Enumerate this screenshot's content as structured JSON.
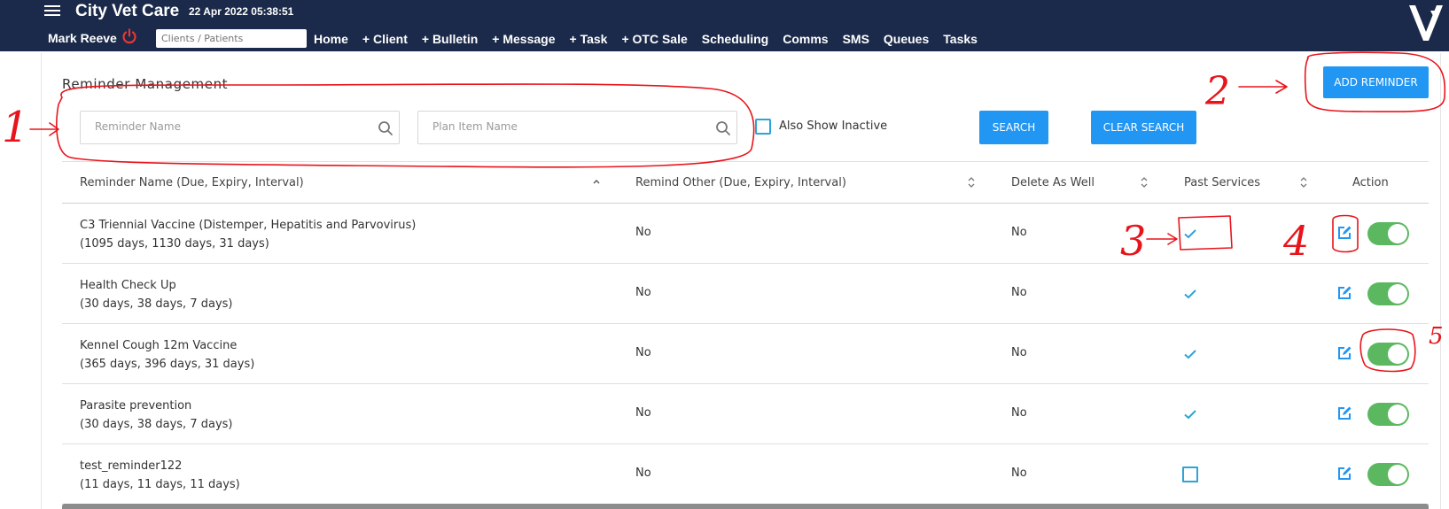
{
  "header": {
    "app_title": "City Vet Care",
    "datetime": "22 Apr 2022 05:38:51",
    "user_name": "Mark Reeve",
    "search_placeholder": "Clients / Patients",
    "nav": [
      "Home",
      "+ Client",
      "+ Bulletin",
      "+ Message",
      "+ Task",
      "+ OTC Sale",
      "Scheduling",
      "Comms",
      "SMS",
      "Queues",
      "Tasks"
    ],
    "colors": {
      "bar": "#1b2a4a",
      "power": "#e53935"
    }
  },
  "page": {
    "title": "Reminder Management",
    "reminder_name_placeholder": "Reminder Name",
    "plan_item_placeholder": "Plan Item Name",
    "also_show_inactive": "Also Show Inactive",
    "search_button": "SEARCH",
    "clear_search_button": "CLEAR SEARCH",
    "add_reminder_button": "ADD REMINDER",
    "accent": "#2196f3"
  },
  "table": {
    "columns": [
      "Reminder Name (Due, Expiry, Interval)",
      "Remind Other (Due, Expiry, Interval)",
      "Delete As Well",
      "Past Services",
      "Action"
    ],
    "rows": [
      {
        "name": "C3 Triennial Vaccine (Distemper, Hepatitis and Parvovirus)",
        "detail": "(1095 days, 1130 days, 31 days)",
        "remind_other": "No",
        "delete_as_well": "No",
        "past_services": true,
        "active": true
      },
      {
        "name": "Health Check Up",
        "detail": "(30 days, 38 days, 7 days)",
        "remind_other": "No",
        "delete_as_well": "No",
        "past_services": true,
        "active": true
      },
      {
        "name": "Kennel Cough 12m Vaccine",
        "detail": "(365 days, 396 days, 31 days)",
        "remind_other": "No",
        "delete_as_well": "No",
        "past_services": true,
        "active": true
      },
      {
        "name": "Parasite prevention",
        "detail": "(30 days, 38 days, 7 days)",
        "remind_other": "No",
        "delete_as_well": "No",
        "past_services": true,
        "active": true
      },
      {
        "name": "test_reminder122",
        "detail": "(11 days, 11 days, 11 days)",
        "remind_other": "No",
        "delete_as_well": "No",
        "past_services": false,
        "active": true
      }
    ]
  },
  "annotations": {
    "labels": [
      "1",
      "2",
      "3",
      "4",
      "5"
    ],
    "color": "#e8141b"
  }
}
